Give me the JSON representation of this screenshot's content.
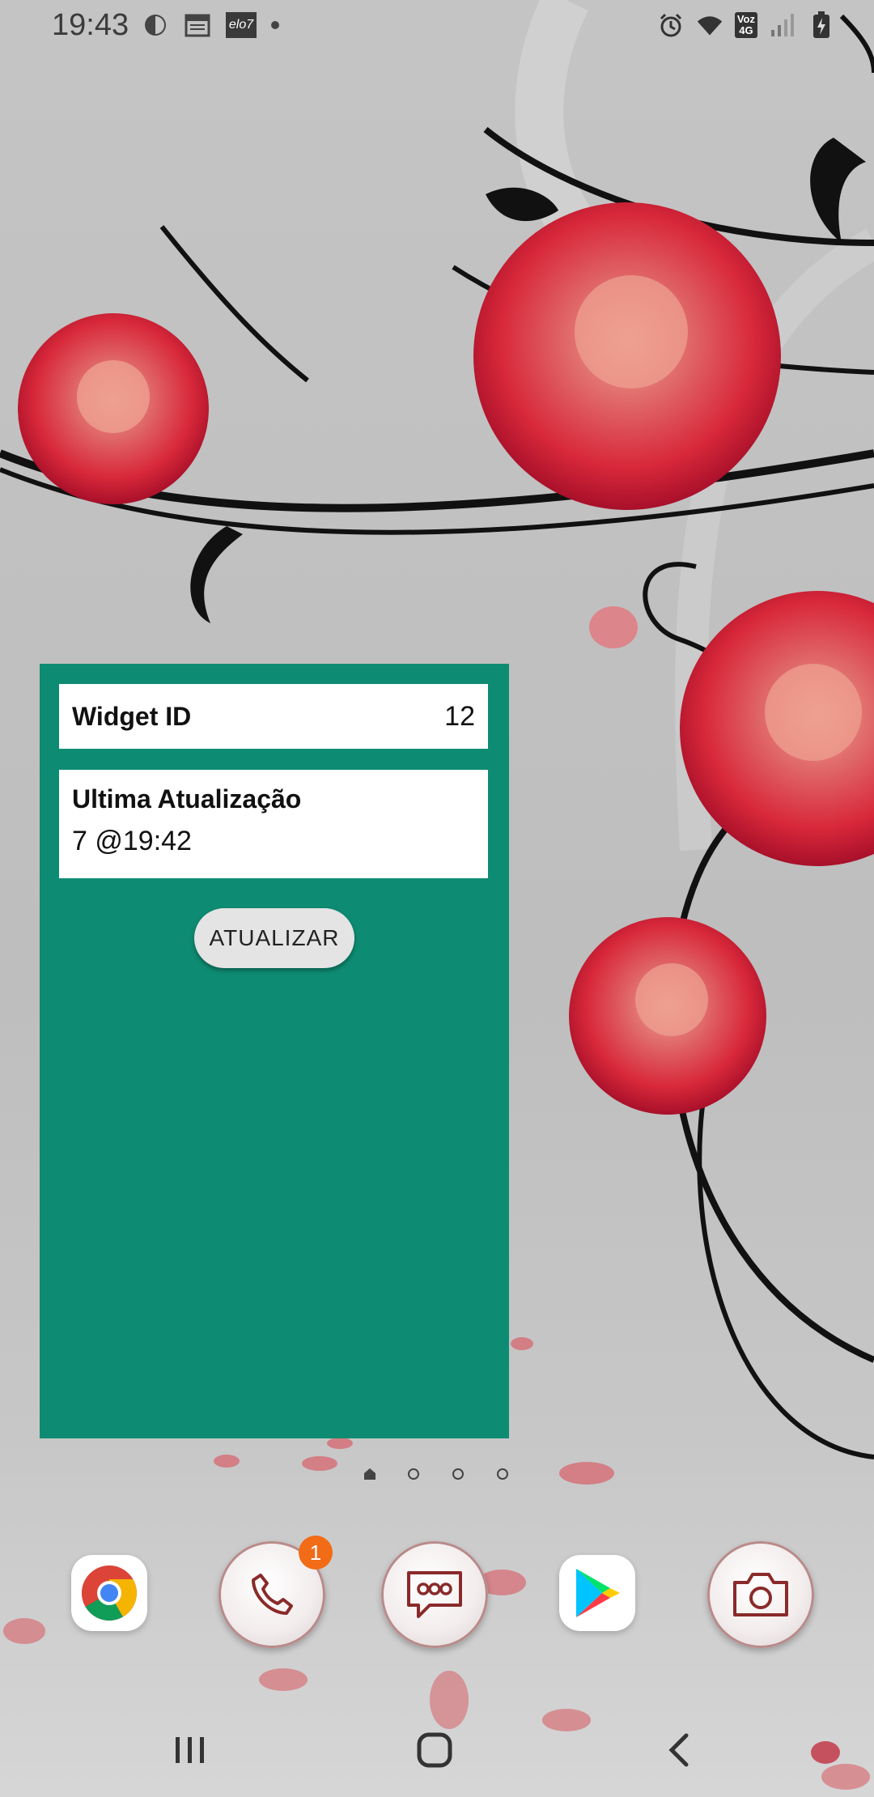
{
  "status_bar": {
    "time": "19:43",
    "left_icons": [
      "sync-icon",
      "calendar-icon",
      "elo7-icon",
      "dot-icon"
    ],
    "elo7_label": "elo7",
    "right_icons": [
      "alarm-icon",
      "wifi-icon",
      "volte-4g-icon",
      "signal-icon",
      "battery-icon"
    ],
    "voz_label_top": "Voz",
    "voz_label_bottom": "4G"
  },
  "widget": {
    "background": "#0e8c73",
    "id_label": "Widget ID",
    "id_value": "12",
    "updated_label": "Ultima Atualização",
    "updated_value": "7 @19:42",
    "update_button": "ATUALIZAR"
  },
  "home_pager": {
    "pages": 4,
    "current": 0
  },
  "dock": {
    "apps": [
      {
        "name": "Chrome",
        "icon": "chrome-icon"
      },
      {
        "name": "Phone",
        "icon": "phone-icon",
        "badge": "1"
      },
      {
        "name": "Messages",
        "icon": "messages-icon"
      },
      {
        "name": "Play Store",
        "icon": "play-store-icon"
      },
      {
        "name": "Camera",
        "icon": "camera-icon"
      }
    ],
    "badge_color": "#f26b16"
  },
  "nav_bar": {
    "buttons": [
      "recents-icon",
      "home-icon",
      "back-icon"
    ]
  }
}
